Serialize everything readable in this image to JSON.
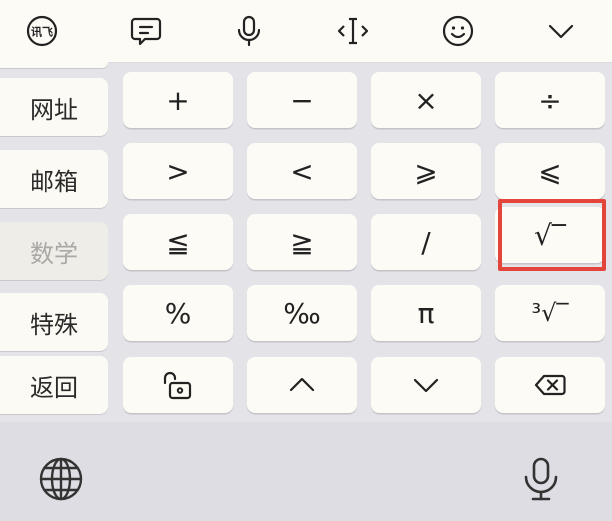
{
  "toolbar": {
    "icons": [
      "logo-icon",
      "text-bubble-icon",
      "microphone-icon",
      "cursor-move-icon",
      "emoji-icon",
      "collapse-icon"
    ],
    "logo_text": "讯飞"
  },
  "categories": {
    "items": [
      {
        "label": "网址"
      },
      {
        "label": "邮箱"
      },
      {
        "label": "数学",
        "state": "selected"
      },
      {
        "label": "特殊"
      },
      {
        "label": "返回"
      }
    ]
  },
  "keys": {
    "row1": [
      "+",
      "−",
      "×",
      "÷"
    ],
    "row2": [
      ">",
      "<",
      "⩾",
      "⩽"
    ],
    "row3": [
      "≦",
      "≧",
      "/",
      "√‾"
    ],
    "row4": [
      "%",
      "‰",
      "π",
      "³√‾"
    ],
    "row5": [
      "lock-open-icon",
      "up-arrow-icon",
      "down-arrow-icon",
      "backspace-icon"
    ]
  },
  "bottom_bar": {
    "icons": [
      "globe-icon",
      "microphone-icon"
    ]
  },
  "colors": {
    "background": "#e4e3e8",
    "key": "#fdfbf6",
    "highlight": "#e4453a"
  }
}
